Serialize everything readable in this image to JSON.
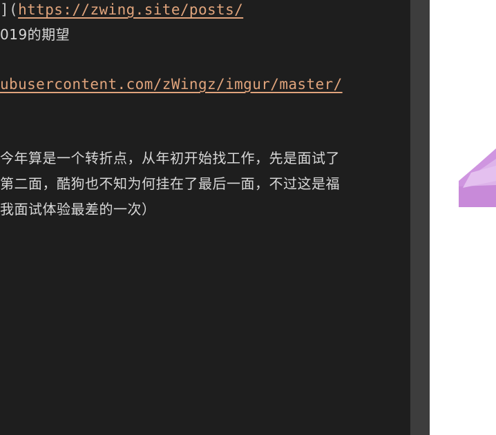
{
  "editor": {
    "line1_prefix": "](",
    "line1_link": "https://zwing.site/posts/",
    "line2_text": "019的期望",
    "line3_link": "ubusercontent.com/zWingz/imgur/master/",
    "para_line1": "今年算是一个转折点，从年初开始找工作，先是面试了",
    "para_line2": "第二面，酷狗也不知为何挂在了最后一面，不过这是福",
    "para_line3": "我面试体验最差的一次）"
  },
  "colors": {
    "editor_bg": "#1e1e1e",
    "link": "#e0a47c",
    "text": "#dcdcdc",
    "scrollbar": "#3d3d3d",
    "preview_bg": "#ffffff",
    "accent_purple": "#c48ad8"
  }
}
